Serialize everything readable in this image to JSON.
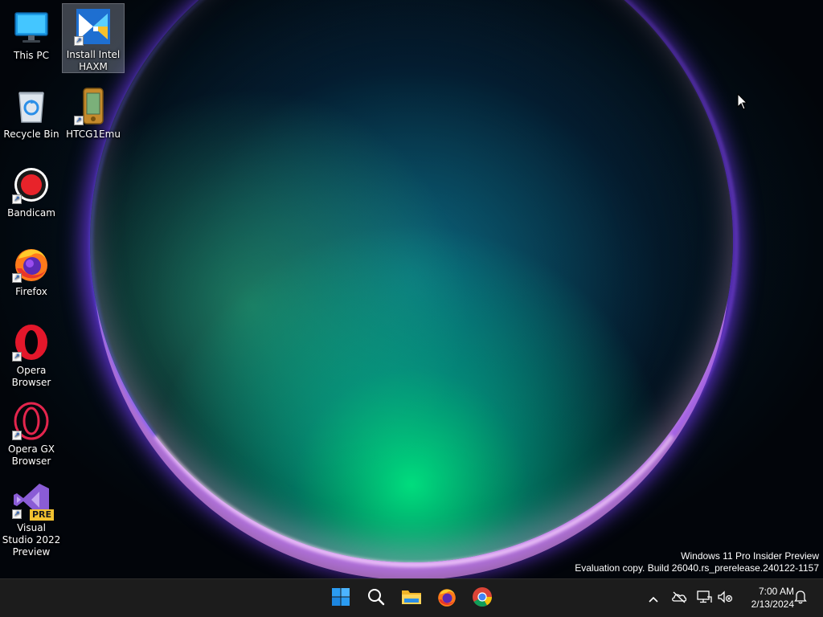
{
  "desktop": {
    "icons": [
      {
        "label": "This PC"
      },
      {
        "label": "Install Intel HAXM"
      },
      {
        "label": "Recycle Bin"
      },
      {
        "label": "HTCG1Emu"
      },
      {
        "label": "Bandicam"
      },
      {
        "label": "Firefox"
      },
      {
        "label": "Opera Browser"
      },
      {
        "label": "Opera GX Browser"
      },
      {
        "label": "Visual Studio 2022 Preview",
        "badge": "PRE"
      }
    ],
    "selected_icon": "Install Intel HAXM"
  },
  "watermark": {
    "line1": "Windows 11 Pro Insider Preview",
    "line2": "Evaluation copy. Build 26040.rs_prerelease.240122-1157"
  },
  "taskbar": {
    "pinned": [
      {
        "name": "start",
        "icon": "windows-logo-icon"
      },
      {
        "name": "search",
        "icon": "search-icon"
      },
      {
        "name": "file-explorer",
        "icon": "folder-icon"
      },
      {
        "name": "firefox",
        "icon": "firefox-icon"
      },
      {
        "name": "chrome",
        "icon": "chrome-icon"
      }
    ],
    "tray": {
      "icons": [
        "chevron-up-icon",
        "onedrive-offline-icon",
        "network-icon",
        "volume-muted-icon"
      ],
      "time": "7:00 AM",
      "date": "2/13/2024",
      "notification_icon": "bell-icon"
    }
  },
  "colors": {
    "taskbar_bg": "#1c1c1c",
    "accent_blue": "#2b8fe8",
    "selection": "#c8d2e6"
  }
}
